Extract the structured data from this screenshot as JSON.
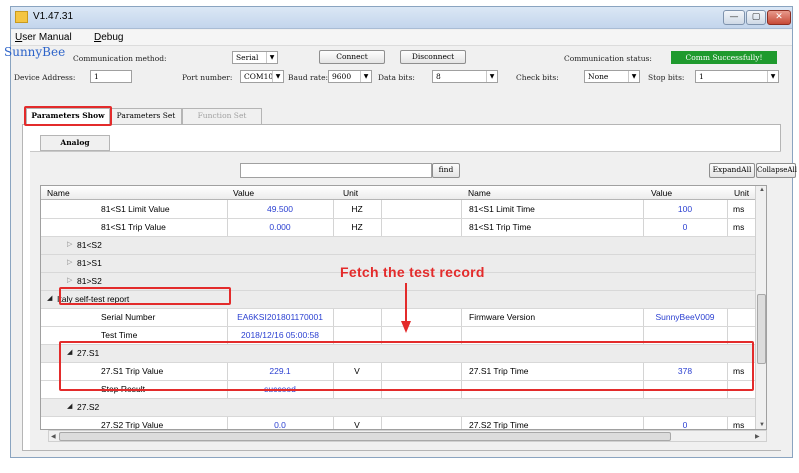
{
  "window": {
    "title": "V1.47.31",
    "min_glyph": "—",
    "max_glyph": "▢",
    "close_glyph": "✕"
  },
  "menu": [
    {
      "underlined": "U",
      "rest": "ser Manual"
    },
    {
      "underlined": "D",
      "rest": "ebug"
    }
  ],
  "connection": {
    "brand": "SunnyBee",
    "method_label": "Communication method:",
    "method_value": "Serial",
    "connect_label": "Connect",
    "disconnect_label": "Disconnect",
    "status_label": "Communication status:",
    "status_value": "Comm Successfully!",
    "device_address_label": "Device Address:",
    "device_address_value": "1",
    "port_label": "Port number:",
    "port_value": "COM10",
    "baud_label": "Baud rate:",
    "baud_value": "9600",
    "data_bits_label": "Data bits:",
    "data_bits_value": "8",
    "check_bits_label": "Check bits:",
    "check_bits_value": "None",
    "stop_bits_label": "Stop bits:",
    "stop_bits_value": "1"
  },
  "tabs": [
    {
      "label": "Parameters Show",
      "state": "active"
    },
    {
      "label": "Parameters Set",
      "state": "normal"
    },
    {
      "label": "Function Set",
      "state": "disabled"
    }
  ],
  "subtab": {
    "label": "Analog"
  },
  "toolbar": {
    "find_label": "find",
    "expand_label": "ExpandAll",
    "collapse_label": "CollapseAll"
  },
  "grid": {
    "headers": [
      "Name",
      "Value",
      "Unit",
      "Name",
      "Value",
      "Unit"
    ],
    "rows": [
      {
        "name": "81<S1 Limit Value",
        "value": "49.500",
        "unit": "HZ",
        "name2": "81<S1 Limit Time",
        "value2": "100",
        "unit2": "ms"
      },
      {
        "name": "81<S1 Trip Value",
        "value": "0.000",
        "unit": "HZ",
        "name2": "81<S1 Trip Time",
        "value2": "0",
        "unit2": "ms"
      },
      {
        "group": "81<S2"
      },
      {
        "group": "81>S1"
      },
      {
        "group": "81>S2"
      },
      {
        "group": "Italy self-test report"
      },
      {
        "name": "Serial Number",
        "value": "EA6KSI201801170001",
        "unit": "",
        "name2": "Firmware Version",
        "value2": "SunnyBeeV009",
        "unit2": ""
      },
      {
        "name": "Test Time",
        "value": "2018/12/16 05:00:58",
        "unit": "",
        "name2": "",
        "value2": "",
        "unit2": ""
      },
      {
        "group": "27.S1"
      },
      {
        "name": "27.S1 Trip Value",
        "value": "229.1",
        "unit": "V",
        "name2": "27.S1 Trip Time",
        "value2": "378",
        "unit2": "ms"
      },
      {
        "name": "Step Result",
        "value": "succeed",
        "unit": "",
        "name2": "",
        "value2": "",
        "unit2": ""
      },
      {
        "group": "27.S2"
      },
      {
        "name": "27.S2 Trip Value",
        "value": "0.0",
        "unit": "V",
        "name2": "27.S2 Trip Time",
        "value2": "0",
        "unit2": "ms"
      }
    ]
  },
  "annotation": {
    "text": "Fetch the test record"
  },
  "colors": {
    "accent": "#e32b2b",
    "status_ok": "#1f9a2e",
    "value_blue": "#2a3fd1",
    "brand": "#2c63c9"
  }
}
